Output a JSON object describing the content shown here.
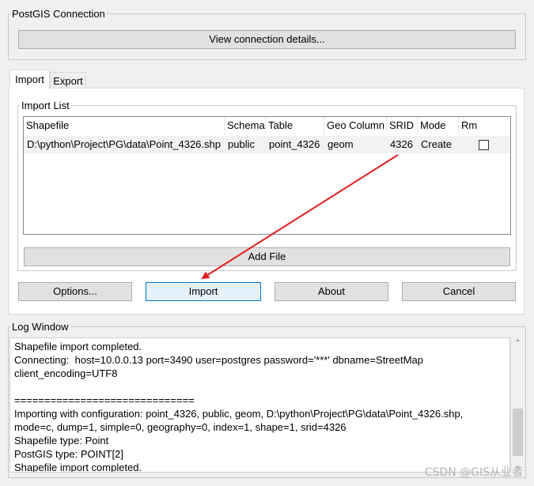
{
  "connection": {
    "group_title": "PostGIS Connection",
    "view_details_label": "View connection details..."
  },
  "tabs": [
    {
      "label": "Import",
      "active": true
    },
    {
      "label": "Export",
      "active": false
    }
  ],
  "import_list": {
    "group_title": "Import List",
    "columns": [
      "Shapefile",
      "Schema",
      "Table",
      "Geo Column",
      "SRID",
      "Mode",
      "Rm"
    ],
    "rows": [
      {
        "shapefile": "D:\\python\\Project\\PG\\data\\Point_4326.shp",
        "schema": "public",
        "table": "point_4326",
        "geo_column": "geom",
        "srid": "4326",
        "mode": "Create",
        "rm": false
      }
    ],
    "add_file_label": "Add File"
  },
  "buttons": {
    "options": "Options...",
    "import": "Import",
    "about": "About",
    "cancel": "Cancel"
  },
  "log": {
    "group_title": "Log Window",
    "lines": [
      "Shapefile import completed.",
      "Connecting:  host=10.0.0.13 port=3490 user=postgres password='***' dbname=StreetMap",
      "client_encoding=UTF8",
      "",
      "==============================",
      "Importing with configuration: point_4326, public, geom, D:\\python\\Project\\PG\\data\\Point_4326.shp,",
      "mode=c, dump=1, simple=0, geography=0, index=1, shape=1, srid=4326",
      "Shapefile type: Point",
      "PostGIS type: POINT[2]",
      "Shapefile import completed."
    ]
  },
  "watermark": "CSDN @GIS从业者",
  "colors": {
    "annotation_arrow": "#e02020",
    "focus_border": "#0078d7"
  }
}
